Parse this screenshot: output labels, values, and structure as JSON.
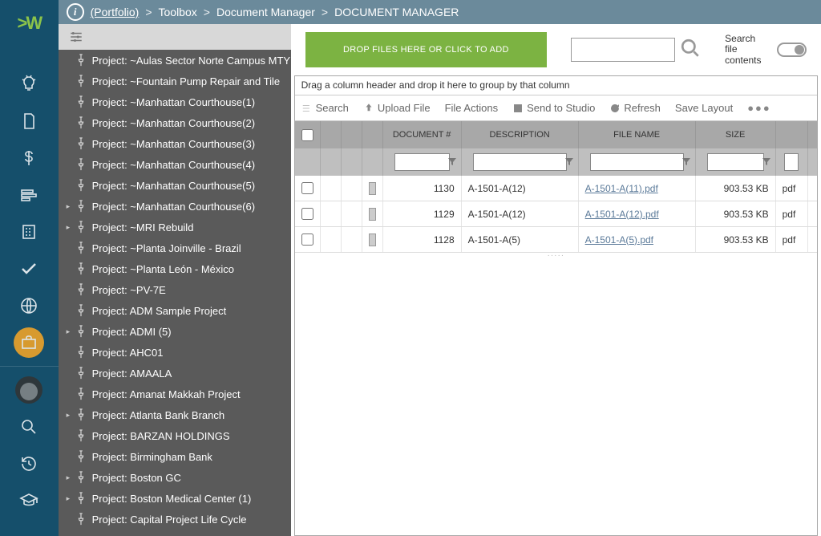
{
  "breadcrumb": {
    "portfolio": "(Portfolio)",
    "toolbox": "Toolbox",
    "docmgr": "Document Manager",
    "current": "DOCUMENT MANAGER"
  },
  "tree": {
    "items": [
      {
        "label": "Project: ~Aulas Sector Norte Campus MTY",
        "expandable": false
      },
      {
        "label": "Project: ~Fountain Pump Repair and Tile",
        "expandable": false
      },
      {
        "label": "Project: ~Manhattan Courthouse(1)",
        "expandable": false
      },
      {
        "label": "Project: ~Manhattan Courthouse(2)",
        "expandable": false
      },
      {
        "label": "Project: ~Manhattan Courthouse(3)",
        "expandable": false
      },
      {
        "label": "Project: ~Manhattan Courthouse(4)",
        "expandable": false
      },
      {
        "label": "Project: ~Manhattan Courthouse(5)",
        "expandable": false
      },
      {
        "label": "Project: ~Manhattan Courthouse(6)",
        "expandable": true
      },
      {
        "label": "Project: ~MRI Rebuild",
        "expandable": true
      },
      {
        "label": "Project: ~Planta Joinville - Brazil",
        "expandable": false
      },
      {
        "label": "Project: ~Planta León - México",
        "expandable": false
      },
      {
        "label": "Project: ~PV-7E",
        "expandable": false
      },
      {
        "label": "Project: ADM Sample Project",
        "expandable": false
      },
      {
        "label": "Project: ADMI (5)",
        "expandable": true
      },
      {
        "label": "Project: AHC01",
        "expandable": false
      },
      {
        "label": "Project: AMAALA",
        "expandable": false
      },
      {
        "label": "Project: Amanat Makkah Project",
        "expandable": false
      },
      {
        "label": "Project: Atlanta Bank Branch",
        "expandable": true
      },
      {
        "label": "Project: BARZAN HOLDINGS",
        "expandable": false
      },
      {
        "label": "Project: Birmingham Bank",
        "expandable": false
      },
      {
        "label": "Project: Boston GC",
        "expandable": true
      },
      {
        "label": "Project: Boston Medical Center (1)",
        "expandable": true
      },
      {
        "label": "Project: Capital Project Life Cycle",
        "expandable": false
      }
    ]
  },
  "dropzone": {
    "label": "DROP FILES HERE OR CLICK TO ADD"
  },
  "search": {
    "contents_label": "Search file\ncontents"
  },
  "grid": {
    "group_hint": "Drag a column header and drop it here to group by that column",
    "toolbar": {
      "search": "Search",
      "upload": "Upload File",
      "actions": "File Actions",
      "studio": "Send to Studio",
      "refresh": "Refresh",
      "save": "Save Layout"
    },
    "columns": {
      "doc": "DOCUMENT #",
      "desc": "DESCRIPTION",
      "file": "FILE NAME",
      "size": "SIZE"
    },
    "rows": [
      {
        "doc": "1130",
        "desc": "A-1501-A(12)",
        "file": "A-1501-A(11).pdf",
        "size": "903.53 KB",
        "ext": "pdf"
      },
      {
        "doc": "1129",
        "desc": "A-1501-A(12)",
        "file": "A-1501-A(12).pdf",
        "size": "903.53 KB",
        "ext": "pdf"
      },
      {
        "doc": "1128",
        "desc": "A-1501-A(5)",
        "file": "A-1501-A(5).pdf",
        "size": "903.53 KB",
        "ext": "pdf"
      }
    ]
  }
}
